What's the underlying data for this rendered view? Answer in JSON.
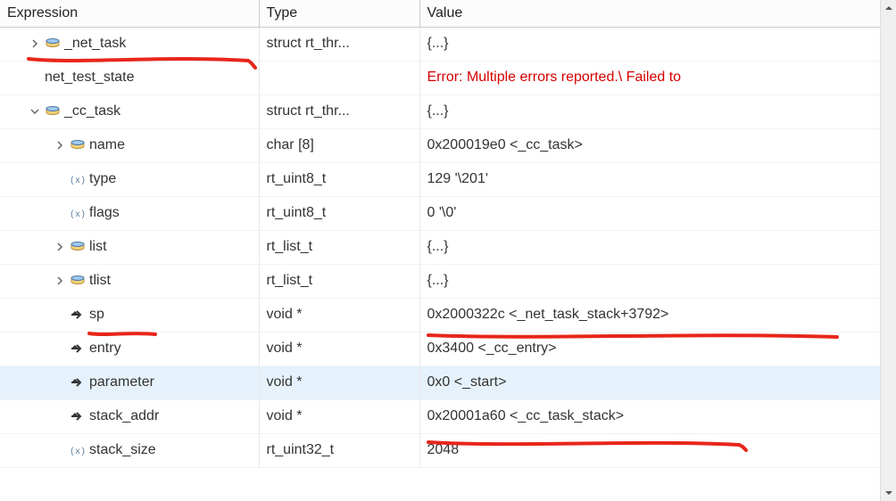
{
  "columns": {
    "expression": "Expression",
    "type": "Type",
    "value": "Value"
  },
  "rows": [
    {
      "indent": 1,
      "disclosure": "closed",
      "icon": "struct",
      "name": "_net_task",
      "type": "struct rt_thr...",
      "value": "{...}"
    },
    {
      "indent": 1,
      "disclosure": "none",
      "icon": "none",
      "name": "net_test_state",
      "type": "",
      "value": "Error: Multiple errors reported.\\ Failed to",
      "error": true
    },
    {
      "indent": 1,
      "disclosure": "open",
      "icon": "struct",
      "name": "_cc_task",
      "type": "struct rt_thr...",
      "value": "{...}"
    },
    {
      "indent": 2,
      "disclosure": "closed",
      "icon": "struct",
      "name": "name",
      "type": "char [8]",
      "value": "0x200019e0 <_cc_task>"
    },
    {
      "indent": 2,
      "disclosure": "none",
      "icon": "var",
      "name": "type",
      "type": "rt_uint8_t",
      "value": "129 '\\201'"
    },
    {
      "indent": 2,
      "disclosure": "none",
      "icon": "var",
      "name": "flags",
      "type": "rt_uint8_t",
      "value": "0 '\\0'"
    },
    {
      "indent": 2,
      "disclosure": "closed",
      "icon": "struct",
      "name": "list",
      "type": "rt_list_t",
      "value": "{...}"
    },
    {
      "indent": 2,
      "disclosure": "closed",
      "icon": "struct",
      "name": "tlist",
      "type": "rt_list_t",
      "value": "{...}"
    },
    {
      "indent": 2,
      "disclosure": "none",
      "icon": "ptr",
      "name": "sp",
      "type": "void *",
      "value": "0x2000322c <_net_task_stack+3792>"
    },
    {
      "indent": 2,
      "disclosure": "none",
      "icon": "ptr",
      "name": "entry",
      "type": "void *",
      "value": "0x3400 <_cc_entry>"
    },
    {
      "indent": 2,
      "disclosure": "none",
      "icon": "ptr",
      "name": "parameter",
      "type": "void *",
      "value": "0x0 <_start>",
      "selected": true
    },
    {
      "indent": 2,
      "disclosure": "none",
      "icon": "ptr",
      "name": "stack_addr",
      "type": "void *",
      "value": "0x20001a60 <_cc_task_stack>"
    },
    {
      "indent": 2,
      "disclosure": "none",
      "icon": "var",
      "name": "stack_size",
      "type": "rt_uint32_t",
      "value": "2048"
    }
  ],
  "annotations": {
    "color": "#e8261a"
  }
}
